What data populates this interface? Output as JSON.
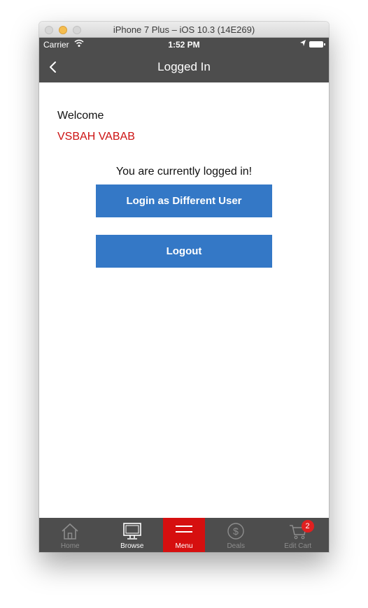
{
  "window": {
    "title": "iPhone 7 Plus – iOS 10.3 (14E269)"
  },
  "status_bar": {
    "carrier": "Carrier",
    "time": "1:52 PM"
  },
  "nav": {
    "title": "Logged In"
  },
  "main": {
    "welcome": "Welcome",
    "username": "VSBAH VABAB",
    "logged_in_message": "You are currently logged in!",
    "different_user_label": "Login as Different User",
    "logout_label": "Logout"
  },
  "tabbar": {
    "items": [
      {
        "label": "Home",
        "icon": "home-icon"
      },
      {
        "label": "Browse",
        "icon": "monitor-icon"
      },
      {
        "label": "Menu",
        "icon": "menu-icon",
        "active": true
      },
      {
        "label": "Deals",
        "icon": "dollar-icon"
      },
      {
        "label": "Edit Cart",
        "icon": "cart-icon",
        "badge": "2"
      }
    ]
  },
  "colors": {
    "bar_bg": "#4d4d4d",
    "accent_red": "#d60f0f",
    "username_red": "#cc1111",
    "button_blue": "#3478c6"
  }
}
